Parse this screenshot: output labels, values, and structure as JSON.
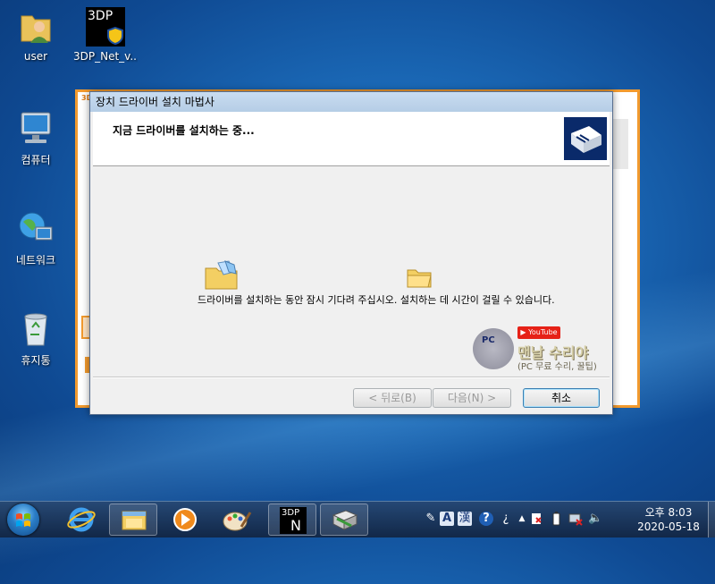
{
  "desktop": {
    "icons": [
      {
        "label": "user",
        "icon": "user-folder-icon"
      },
      {
        "label": "3DP_Net_v...",
        "icon": "3dp-net-icon"
      },
      {
        "label": "컴퓨터",
        "icon": "computer-icon"
      },
      {
        "label": "네트워크",
        "icon": "network-icon"
      },
      {
        "label": "휴지통",
        "icon": "recycle-bin-icon"
      }
    ],
    "badge_3dp": "3DP"
  },
  "background_window": {
    "tag": "3D"
  },
  "wizard": {
    "title": "장치 드라이버 설치 마법사",
    "heading": "지금 드라이버를 설치하는 중...",
    "message": "드라이버를 설치하는 동안 잠시 기다려 주십시오. 설치하는 데 시간이 걸릴 수 있습니다.",
    "buttons": {
      "back": "< 뒤로(B)",
      "next": "다음(N) >",
      "cancel": "취소"
    }
  },
  "watermark": {
    "youtube": "▶ YouTube",
    "logo": "PC",
    "name": "맨날 수리야",
    "subtitle": "(PC 무료 수리, 꿀팁)"
  },
  "taskbar": {
    "pinned": [
      "internet-explorer-icon",
      "windows-explorer-icon",
      "media-player-icon",
      "paint-icon",
      "3dp-net-task-icon",
      "driver-setup-task-icon"
    ],
    "task_3dp_top": "3DP",
    "task_3dp_letter": "N",
    "tray": {
      "ime_a": "A",
      "ime_han": "漢"
    },
    "clock": {
      "time": "오후 8:03",
      "date": "2020-05-18"
    }
  }
}
